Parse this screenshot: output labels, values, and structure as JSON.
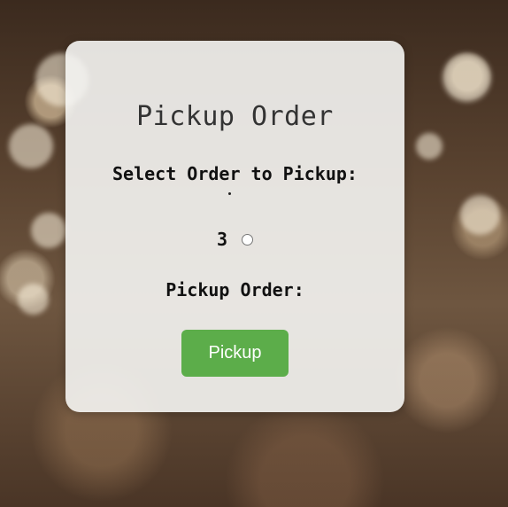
{
  "card": {
    "title": "Pickup Order",
    "select_label": "Select Order to Pickup:",
    "orders": [
      {
        "number": "3",
        "selected": false
      }
    ],
    "pickup_label": "Pickup Order:",
    "pickup_button_label": "Pickup"
  },
  "colors": {
    "button_bg": "#5cad4a",
    "card_bg": "#f5f5f3"
  }
}
